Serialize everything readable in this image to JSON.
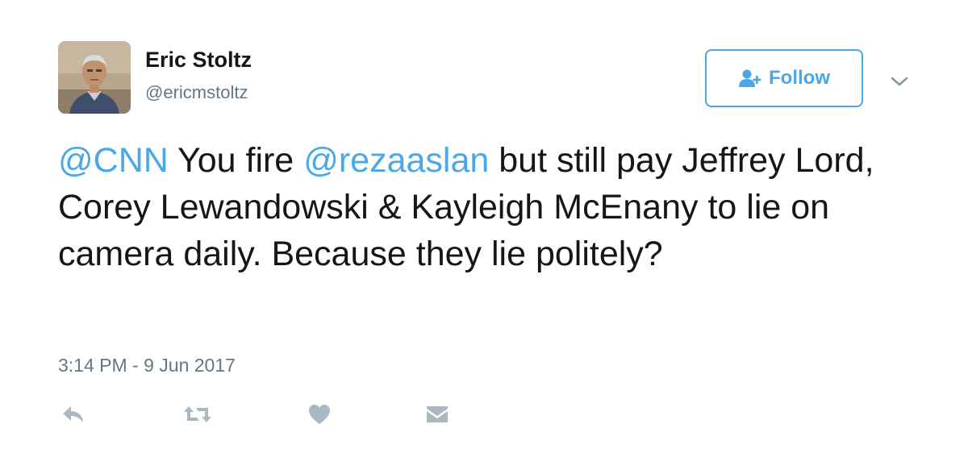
{
  "author": {
    "name": "Eric Stoltz",
    "handle": "@ericmstoltz"
  },
  "follow_button": {
    "label": "Follow",
    "icon": "user-plus-icon"
  },
  "menu": {
    "icon": "chevron-down-icon"
  },
  "tweet": {
    "segments": [
      {
        "text": "@CNN",
        "mention": true
      },
      {
        "text": " You fire ",
        "mention": false
      },
      {
        "text": "@rezaaslan",
        "mention": true
      },
      {
        "text": " but still pay Jeffrey Lord, Corey Lewandowski & Kayleigh McEnany to lie on camera daily. Because they lie politely?",
        "mention": false
      }
    ]
  },
  "timestamp": "3:14 PM - 9 Jun 2017",
  "actions": [
    {
      "icon": "reply-icon"
    },
    {
      "icon": "retweet-icon"
    },
    {
      "icon": "heart-icon"
    },
    {
      "icon": "envelope-icon"
    }
  ],
  "colors": {
    "accent": "#4aa8e8",
    "text": "#14171a",
    "secondary": "#657786",
    "icon": "#aab8c2"
  }
}
